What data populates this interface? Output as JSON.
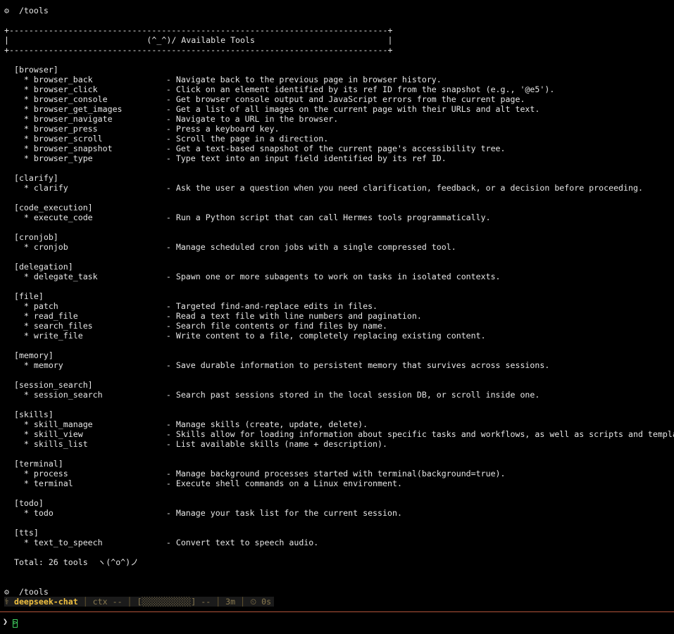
{
  "command_echo": {
    "icon": "gear-icon",
    "glyph": "⚙",
    "text": "/tools"
  },
  "banner": {
    "border": "+-----------------------------------------------------------------------------+",
    "title_line": "|                            (^_^)/ Available Tools                           |"
  },
  "groups": [
    {
      "name": "[browser]",
      "tools": [
        {
          "name": "browser_back",
          "desc": "- Navigate back to the previous page in browser history."
        },
        {
          "name": "browser_click",
          "desc": "- Click on an element identified by its ref ID from the snapshot (e.g., '@e5')."
        },
        {
          "name": "browser_console",
          "desc": "- Get browser console output and JavaScript errors from the current page."
        },
        {
          "name": "browser_get_images",
          "desc": "- Get a list of all images on the current page with their URLs and alt text."
        },
        {
          "name": "browser_navigate",
          "desc": "- Navigate to a URL in the browser."
        },
        {
          "name": "browser_press",
          "desc": "- Press a keyboard key."
        },
        {
          "name": "browser_scroll",
          "desc": "- Scroll the page in a direction."
        },
        {
          "name": "browser_snapshot",
          "desc": "- Get a text-based snapshot of the current page's accessibility tree."
        },
        {
          "name": "browser_type",
          "desc": "- Type text into an input field identified by its ref ID."
        }
      ]
    },
    {
      "name": "[clarify]",
      "tools": [
        {
          "name": "clarify",
          "desc": "- Ask the user a question when you need clarification, feedback, or a decision before proceeding."
        }
      ]
    },
    {
      "name": "[code_execution]",
      "tools": [
        {
          "name": "execute_code",
          "desc": "- Run a Python script that can call Hermes tools programmatically."
        }
      ]
    },
    {
      "name": "[cronjob]",
      "tools": [
        {
          "name": "cronjob",
          "desc": "- Manage scheduled cron jobs with a single compressed tool."
        }
      ]
    },
    {
      "name": "[delegation]",
      "tools": [
        {
          "name": "delegate_task",
          "desc": "- Spawn one or more subagents to work on tasks in isolated contexts."
        }
      ]
    },
    {
      "name": "[file]",
      "tools": [
        {
          "name": "patch",
          "desc": "- Targeted find-and-replace edits in files."
        },
        {
          "name": "read_file",
          "desc": "- Read a text file with line numbers and pagination."
        },
        {
          "name": "search_files",
          "desc": "- Search file contents or find files by name."
        },
        {
          "name": "write_file",
          "desc": "- Write content to a file, completely replacing existing content."
        }
      ]
    },
    {
      "name": "[memory]",
      "tools": [
        {
          "name": "memory",
          "desc": "- Save durable information to persistent memory that survives across sessions."
        }
      ]
    },
    {
      "name": "[session_search]",
      "tools": [
        {
          "name": "session_search",
          "desc": "- Search past sessions stored in the local session DB, or scroll inside one."
        }
      ]
    },
    {
      "name": "[skills]",
      "tools": [
        {
          "name": "skill_manage",
          "desc": "- Manage skills (create, update, delete)."
        },
        {
          "name": "skill_view",
          "desc": "- Skills allow for loading information about specific tasks and workflows, as well as scripts and templates."
        },
        {
          "name": "skills_list",
          "desc": "- List available skills (name + description)."
        }
      ]
    },
    {
      "name": "[terminal]",
      "tools": [
        {
          "name": "process",
          "desc": "- Manage background processes started with terminal(background=true)."
        },
        {
          "name": "terminal",
          "desc": "- Execute shell commands on a Linux environment."
        }
      ]
    },
    {
      "name": "[todo]",
      "tools": [
        {
          "name": "todo",
          "desc": "- Manage your task list for the current session."
        }
      ]
    },
    {
      "name": "[tts]",
      "tools": [
        {
          "name": "text_to_speech",
          "desc": "- Convert text to speech audio."
        }
      ]
    }
  ],
  "total": {
    "text": "Total: 26 tools",
    "emoticon": "ヽ(^o^)ノ"
  },
  "prompt_echo": {
    "icon": "gear-icon",
    "glyph": "⚙",
    "text": "/tools"
  },
  "status_bar": {
    "prefix_glyph": "⚕",
    "model": "deepseek-chat",
    "ctx": "ctx --",
    "progress": "[░░░░░░░░░░] --",
    "elapsed": "3m",
    "timer_glyph": "⏲",
    "timer": "0s"
  },
  "prompt": {
    "caret": "❯",
    "cursor": "⊳"
  },
  "colors": {
    "background": "#000000",
    "text": "#e6e6e6",
    "model_accent": "#f0c040",
    "rule": "#b3543a",
    "cursor": "#40d060"
  }
}
